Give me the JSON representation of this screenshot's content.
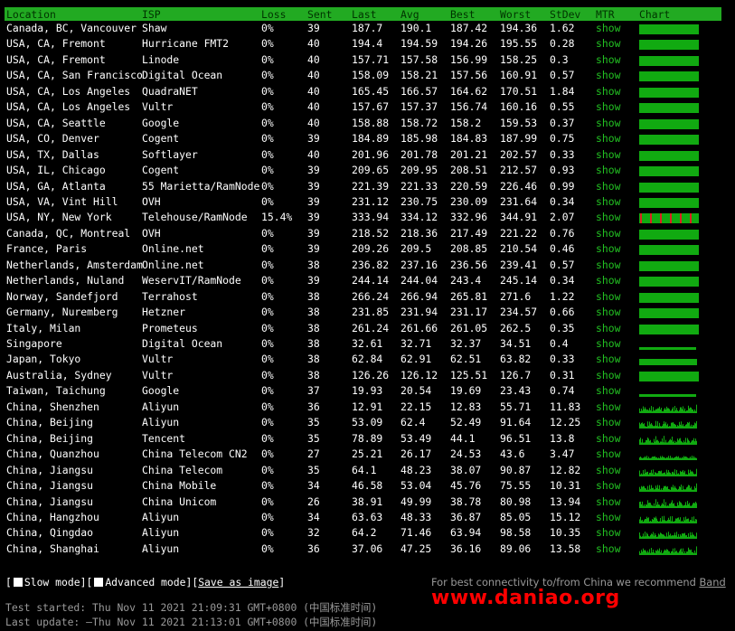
{
  "headers": [
    "Location",
    "ISP",
    "Loss",
    "Sent",
    "Last",
    "Avg",
    "Best",
    "Worst",
    "StDev",
    "MTR",
    "Chart"
  ],
  "colors": {
    "header_bg": "#22aa22",
    "show_link": "#22c022",
    "bar": "#11aa11",
    "loss_mark": "#dd2222",
    "watermark": "#ff0000"
  },
  "rows": [
    {
      "location": "Canada, BC, Vancouver",
      "isp": "Shaw",
      "loss": "0%",
      "sent": "39",
      "last": "187.7",
      "avg": "190.1",
      "best": "187.42",
      "worst": "194.36",
      "stdev": "1.62",
      "mtr": "show",
      "chart": "solid",
      "loss_marks": 0
    },
    {
      "location": "USA, CA, Fremont",
      "isp": "Hurricane FMT2",
      "loss": "0%",
      "sent": "40",
      "last": "194.4",
      "avg": "194.59",
      "best": "194.26",
      "worst": "195.55",
      "stdev": "0.28",
      "mtr": "show",
      "chart": "solid",
      "loss_marks": 0
    },
    {
      "location": "USA, CA, Fremont",
      "isp": "Linode",
      "loss": "0%",
      "sent": "40",
      "last": "157.71",
      "avg": "157.58",
      "best": "156.99",
      "worst": "158.25",
      "stdev": "0.3",
      "mtr": "show",
      "chart": "solid",
      "loss_marks": 0
    },
    {
      "location": "USA, CA, San Francisco",
      "isp": "Digital Ocean",
      "loss": "0%",
      "sent": "40",
      "last": "158.09",
      "avg": "158.21",
      "best": "157.56",
      "worst": "160.91",
      "stdev": "0.57",
      "mtr": "show",
      "chart": "solid",
      "loss_marks": 0
    },
    {
      "location": "USA, CA, Los Angeles",
      "isp": "QuadraNET",
      "loss": "0%",
      "sent": "40",
      "last": "165.45",
      "avg": "166.57",
      "best": "164.62",
      "worst": "170.51",
      "stdev": "1.84",
      "mtr": "show",
      "chart": "solid",
      "loss_marks": 0
    },
    {
      "location": "USA, CA, Los Angeles",
      "isp": "Vultr",
      "loss": "0%",
      "sent": "40",
      "last": "157.67",
      "avg": "157.37",
      "best": "156.74",
      "worst": "160.16",
      "stdev": "0.55",
      "mtr": "show",
      "chart": "solid",
      "loss_marks": 0
    },
    {
      "location": "USA, CA, Seattle",
      "isp": "Google",
      "loss": "0%",
      "sent": "40",
      "last": "158.88",
      "avg": "158.72",
      "best": "158.2",
      "worst": "159.53",
      "stdev": "0.37",
      "mtr": "show",
      "chart": "solid",
      "loss_marks": 0
    },
    {
      "location": "USA, CO, Denver",
      "isp": "Cogent",
      "loss": "0%",
      "sent": "39",
      "last": "184.89",
      "avg": "185.98",
      "best": "184.83",
      "worst": "187.99",
      "stdev": "0.75",
      "mtr": "show",
      "chart": "solid",
      "loss_marks": 0
    },
    {
      "location": "USA, TX, Dallas",
      "isp": "Softlayer",
      "loss": "0%",
      "sent": "40",
      "last": "201.96",
      "avg": "201.78",
      "best": "201.21",
      "worst": "202.57",
      "stdev": "0.33",
      "mtr": "show",
      "chart": "solid",
      "loss_marks": 0
    },
    {
      "location": "USA, IL, Chicago",
      "isp": "Cogent",
      "loss": "0%",
      "sent": "39",
      "last": "209.65",
      "avg": "209.95",
      "best": "208.51",
      "worst": "212.57",
      "stdev": "0.93",
      "mtr": "show",
      "chart": "solid",
      "loss_marks": 0
    },
    {
      "location": "USA, GA, Atlanta",
      "isp": "55 Marietta/RamNode",
      "loss": "0%",
      "sent": "39",
      "last": "221.39",
      "avg": "221.33",
      "best": "220.59",
      "worst": "226.46",
      "stdev": "0.99",
      "mtr": "show",
      "chart": "solid",
      "loss_marks": 0
    },
    {
      "location": "USA, VA, Vint Hill",
      "isp": "OVH",
      "loss": "0%",
      "sent": "39",
      "last": "231.12",
      "avg": "230.75",
      "best": "230.09",
      "worst": "231.64",
      "stdev": "0.34",
      "mtr": "show",
      "chart": "solid",
      "loss_marks": 0
    },
    {
      "location": "USA, NY, New York",
      "isp": "Telehouse/RamNode",
      "loss": "15.4%",
      "sent": "39",
      "last": "333.94",
      "avg": "334.12",
      "best": "332.96",
      "worst": "344.91",
      "stdev": "2.07",
      "mtr": "show",
      "chart": "solid",
      "loss_marks": 6
    },
    {
      "location": "Canada, QC, Montreal",
      "isp": "OVH",
      "loss": "0%",
      "sent": "39",
      "last": "218.52",
      "avg": "218.36",
      "best": "217.49",
      "worst": "221.22",
      "stdev": "0.76",
      "mtr": "show",
      "chart": "solid",
      "loss_marks": 0
    },
    {
      "location": "France, Paris",
      "isp": "Online.net",
      "loss": "0%",
      "sent": "39",
      "last": "209.26",
      "avg": "209.5",
      "best": "208.85",
      "worst": "210.54",
      "stdev": "0.46",
      "mtr": "show",
      "chart": "solid",
      "loss_marks": 0
    },
    {
      "location": "Netherlands, Amsterdam",
      "isp": "Online.net",
      "loss": "0%",
      "sent": "38",
      "last": "236.82",
      "avg": "237.16",
      "best": "236.56",
      "worst": "239.41",
      "stdev": "0.57",
      "mtr": "show",
      "chart": "solid",
      "loss_marks": 0
    },
    {
      "location": "Netherlands, Nuland",
      "isp": "WeservIT/RamNode",
      "loss": "0%",
      "sent": "39",
      "last": "244.14",
      "avg": "244.04",
      "best": "243.4",
      "worst": "245.14",
      "stdev": "0.34",
      "mtr": "show",
      "chart": "solid",
      "loss_marks": 0
    },
    {
      "location": "Norway, Sandefjord",
      "isp": "Terrahost",
      "loss": "0%",
      "sent": "38",
      "last": "266.24",
      "avg": "266.94",
      "best": "265.81",
      "worst": "271.6",
      "stdev": "1.22",
      "mtr": "show",
      "chart": "solid",
      "loss_marks": 0
    },
    {
      "location": "Germany, Nuremberg",
      "isp": "Hetzner",
      "loss": "0%",
      "sent": "38",
      "last": "231.85",
      "avg": "231.94",
      "best": "231.17",
      "worst": "234.57",
      "stdev": "0.66",
      "mtr": "show",
      "chart": "solid",
      "loss_marks": 0
    },
    {
      "location": "Italy, Milan",
      "isp": "Prometeus",
      "loss": "0%",
      "sent": "38",
      "last": "261.24",
      "avg": "261.66",
      "best": "261.05",
      "worst": "262.5",
      "stdev": "0.35",
      "mtr": "show",
      "chart": "solid",
      "loss_marks": 0
    },
    {
      "location": "Singapore",
      "isp": "Digital Ocean",
      "loss": "0%",
      "sent": "38",
      "last": "32.61",
      "avg": "32.71",
      "best": "32.37",
      "worst": "34.51",
      "stdev": "0.4",
      "mtr": "show",
      "chart": "thin",
      "loss_marks": 0
    },
    {
      "location": "Japan, Tokyo",
      "isp": "Vultr",
      "loss": "0%",
      "sent": "38",
      "last": "62.84",
      "avg": "62.91",
      "best": "62.51",
      "worst": "63.82",
      "stdev": "0.33",
      "mtr": "show",
      "chart": "medium",
      "loss_marks": 0
    },
    {
      "location": "Australia, Sydney",
      "isp": "Vultr",
      "loss": "0%",
      "sent": "38",
      "last": "126.26",
      "avg": "126.12",
      "best": "125.51",
      "worst": "126.7",
      "stdev": "0.31",
      "mtr": "show",
      "chart": "solid",
      "loss_marks": 0
    },
    {
      "location": "Taiwan, Taichung",
      "isp": "Google",
      "loss": "0%",
      "sent": "37",
      "last": "19.93",
      "avg": "20.54",
      "best": "19.69",
      "worst": "23.43",
      "stdev": "0.74",
      "mtr": "show",
      "chart": "thin",
      "loss_marks": 0
    },
    {
      "location": "China, Shenzhen",
      "isp": "Aliyun",
      "loss": "0%",
      "sent": "36",
      "last": "12.91",
      "avg": "22.15",
      "best": "12.83",
      "worst": "55.71",
      "stdev": "11.83",
      "mtr": "show",
      "chart": "spiky",
      "loss_marks": 0
    },
    {
      "location": "China, Beijing",
      "isp": "Aliyun",
      "loss": "0%",
      "sent": "35",
      "last": "53.09",
      "avg": "62.4",
      "best": "52.49",
      "worst": "91.64",
      "stdev": "12.25",
      "mtr": "show",
      "chart": "spiky",
      "loss_marks": 0
    },
    {
      "location": "China, Beijing",
      "isp": "Tencent",
      "loss": "0%",
      "sent": "35",
      "last": "78.89",
      "avg": "53.49",
      "best": "44.1",
      "worst": "96.51",
      "stdev": "13.8",
      "mtr": "show",
      "chart": "spiky",
      "loss_marks": 0
    },
    {
      "location": "China, Quanzhou",
      "isp": "China Telecom CN2",
      "loss": "0%",
      "sent": "27",
      "last": "25.21",
      "avg": "26.17",
      "best": "24.53",
      "worst": "43.6",
      "stdev": "3.47",
      "mtr": "show",
      "chart": "spiky-low",
      "loss_marks": 0
    },
    {
      "location": "China, Jiangsu",
      "isp": "China Telecom",
      "loss": "0%",
      "sent": "35",
      "last": "64.1",
      "avg": "48.23",
      "best": "38.07",
      "worst": "90.87",
      "stdev": "12.82",
      "mtr": "show",
      "chart": "spiky",
      "loss_marks": 0
    },
    {
      "location": "China, Jiangsu",
      "isp": "China Mobile",
      "loss": "0%",
      "sent": "34",
      "last": "46.58",
      "avg": "53.04",
      "best": "45.76",
      "worst": "75.55",
      "stdev": "10.31",
      "mtr": "show",
      "chart": "spiky",
      "loss_marks": 0
    },
    {
      "location": "China, Jiangsu",
      "isp": "China Unicom",
      "loss": "0%",
      "sent": "26",
      "last": "38.91",
      "avg": "49.99",
      "best": "38.78",
      "worst": "80.98",
      "stdev": "13.94",
      "mtr": "show",
      "chart": "spiky",
      "loss_marks": 0
    },
    {
      "location": "China, Hangzhou",
      "isp": "Aliyun",
      "loss": "0%",
      "sent": "34",
      "last": "63.63",
      "avg": "48.33",
      "best": "36.87",
      "worst": "85.05",
      "stdev": "15.12",
      "mtr": "show",
      "chart": "spiky",
      "loss_marks": 0
    },
    {
      "location": "China, Qingdao",
      "isp": "Aliyun",
      "loss": "0%",
      "sent": "32",
      "last": "64.2",
      "avg": "71.46",
      "best": "63.94",
      "worst": "98.58",
      "stdev": "10.35",
      "mtr": "show",
      "chart": "spiky",
      "loss_marks": 0
    },
    {
      "location": "China, Shanghai",
      "isp": "Aliyun",
      "loss": "0%",
      "sent": "36",
      "last": "37.06",
      "avg": "47.25",
      "best": "36.16",
      "worst": "89.06",
      "stdev": "13.58",
      "mtr": "show",
      "chart": "spiky",
      "loss_marks": 0
    }
  ],
  "controls": {
    "slow_mode": "Slow mode",
    "advanced_mode": "Advanced mode",
    "save_as_image": "Save as image"
  },
  "recommend": {
    "text": "For best connectivity to/from China we recommend ",
    "link": "Band"
  },
  "times": {
    "started": "Test started: Thu Nov 11 2021 21:09:31 GMT+0800 (中国标准时间)",
    "updated": "Last update: —Thu Nov 11 2021 21:13:01 GMT+0800 (中国标准时间)"
  },
  "watermark": "www.daniao.org"
}
